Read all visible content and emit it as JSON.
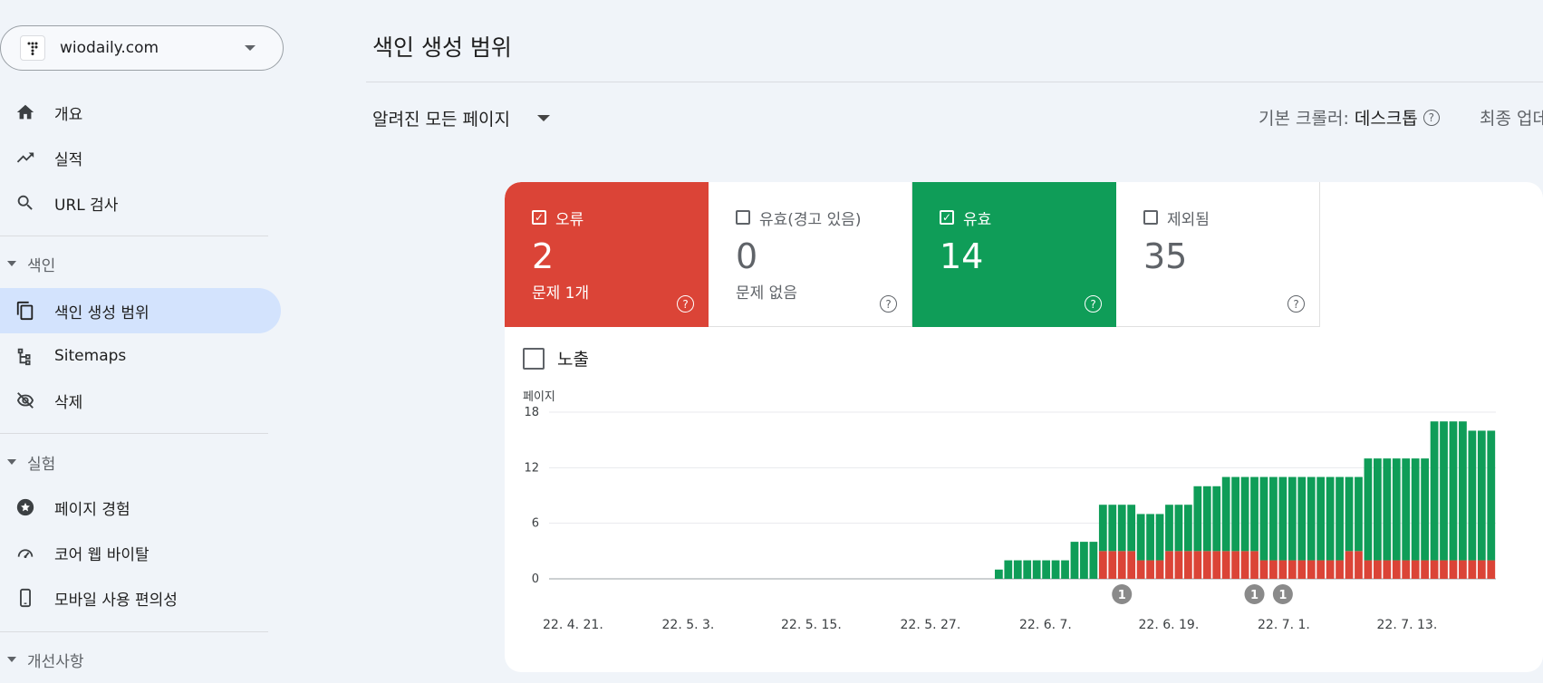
{
  "sidebar": {
    "property": {
      "name": "wiodaily.com"
    },
    "items_top": [
      {
        "label": "개요",
        "icon": "home-icon"
      },
      {
        "label": "실적",
        "icon": "trending-up-icon"
      },
      {
        "label": "URL 검사",
        "icon": "search-icon"
      }
    ],
    "section_index": {
      "label": "색인"
    },
    "items_index": [
      {
        "label": "색인 생성 범위",
        "icon": "copy-pages-icon",
        "active": true
      },
      {
        "label": "Sitemaps",
        "icon": "sitemap-icon"
      },
      {
        "label": "삭제",
        "icon": "eye-off-icon"
      }
    ],
    "section_experience": {
      "label": "실험"
    },
    "items_experience": [
      {
        "label": "페이지 경험",
        "icon": "star-circle-icon"
      },
      {
        "label": "코어 웹 바이탈",
        "icon": "gauge-icon"
      },
      {
        "label": "모바일 사용 편의성",
        "icon": "smartphone-icon"
      }
    ],
    "section_enhancements": {
      "label": "개선사항"
    }
  },
  "header": {
    "title": "색인 생성 범위",
    "filter": "알려진 모든 페이지",
    "crawler_label": "기본 크롤러:",
    "crawler_value": "데스크톱",
    "last_update": "최종 업데"
  },
  "tiles": [
    {
      "title": "오류",
      "count": "2",
      "sub": "문제 1개",
      "checked": true,
      "color": "#db4437"
    },
    {
      "title": "유효(경고 있음)",
      "count": "0",
      "sub": "문제 없음",
      "checked": false
    },
    {
      "title": "유효",
      "count": "14",
      "sub": "",
      "checked": true,
      "color": "#0f9d58"
    },
    {
      "title": "제외됨",
      "count": "35",
      "sub": "",
      "checked": false
    }
  ],
  "impressions": {
    "label": "노출"
  },
  "chart_data": {
    "type": "bar",
    "ylabel": "페이지",
    "ylim": [
      0,
      18
    ],
    "yticks": [
      0,
      6,
      12,
      18
    ],
    "xtick_labels": [
      "22. 4. 21.",
      "22. 5. 3.",
      "22. 5. 15.",
      "22. 5. 27.",
      "22. 6. 7.",
      "22. 6. 19.",
      "22. 7. 1.",
      "22. 7. 13."
    ],
    "series_colors": {
      "error": "#db4437",
      "valid": "#0f9d58"
    },
    "series": [
      {
        "name": "오류",
        "values": [
          0,
          0,
          0,
          0,
          0,
          0,
          0,
          0,
          0,
          0,
          0,
          0,
          0,
          0,
          0,
          0,
          0,
          0,
          0,
          0,
          0,
          0,
          0,
          0,
          0,
          0,
          0,
          0,
          0,
          0,
          0,
          0,
          0,
          0,
          0,
          0,
          0,
          0,
          0,
          0,
          0,
          0,
          0,
          0,
          0,
          0,
          0,
          0,
          0,
          0,
          0,
          0,
          0,
          0,
          0,
          0,
          0,
          0,
          3,
          3,
          3,
          3,
          2,
          2,
          2,
          3,
          3,
          3,
          3,
          3,
          3,
          3,
          3,
          3,
          3,
          2,
          2,
          2,
          2,
          2,
          2,
          2,
          2,
          2,
          3,
          3,
          2,
          2,
          2,
          2,
          2,
          2,
          2,
          2,
          2,
          2,
          2,
          2,
          2,
          2
        ]
      },
      {
        "name": "유효",
        "values": [
          0,
          0,
          0,
          0,
          0,
          0,
          0,
          0,
          0,
          0,
          0,
          0,
          0,
          0,
          0,
          0,
          0,
          0,
          0,
          0,
          0,
          0,
          0,
          0,
          0,
          0,
          0,
          0,
          0,
          0,
          0,
          0,
          0,
          0,
          0,
          0,
          0,
          0,
          0,
          0,
          0,
          0,
          0,
          0,
          0,
          0,
          0,
          1,
          2,
          2,
          2,
          2,
          2,
          2,
          2,
          4,
          4,
          4,
          5,
          5,
          5,
          5,
          5,
          5,
          5,
          5,
          5,
          5,
          7,
          7,
          7,
          8,
          8,
          8,
          8,
          9,
          9,
          9,
          9,
          9,
          9,
          9,
          9,
          9,
          8,
          8,
          11,
          11,
          11,
          11,
          11,
          11,
          11,
          15,
          15,
          15,
          15,
          14,
          14,
          14
        ]
      }
    ],
    "annotations": [
      {
        "bar_index": 60,
        "label": "1"
      },
      {
        "bar_index": 74,
        "label": "1"
      },
      {
        "bar_index": 77,
        "label": "1"
      }
    ]
  }
}
